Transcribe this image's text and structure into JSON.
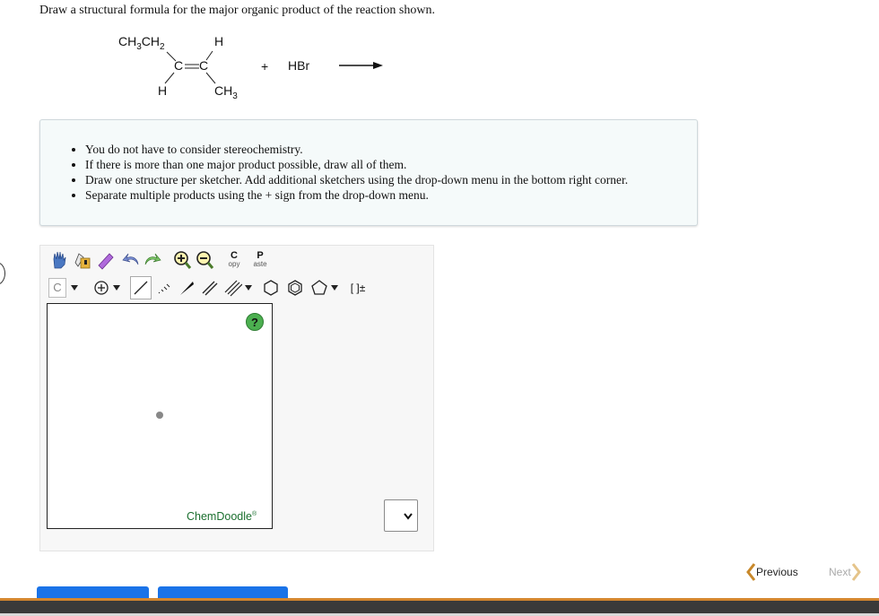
{
  "question": {
    "text": "Draw a structural formula for the major organic product of the reaction shown."
  },
  "reaction": {
    "sub_ch3ch2_main": "CH",
    "sub_ch3ch2_3": "3",
    "sub_ch3ch2_ch": "CH",
    "sub_ch3ch2_2": "2",
    "h_top": "H",
    "c_left": "C",
    "c_right": "C",
    "h_bottom": "H",
    "ch3_main": "CH",
    "ch3_sub": "3",
    "plus": "+",
    "reagent": "HBr"
  },
  "instructions": {
    "items": [
      "You do not have to consider stereochemistry.",
      "If there is more than one major product possible, draw all of them.",
      "Draw one structure per sketcher. Add additional sketchers using the drop-down menu in the bottom right corner.",
      "Separate multiple products using the + sign from the drop-down menu."
    ]
  },
  "toolbar": {
    "copy_top": "C",
    "copy_bottom": "opy",
    "paste_top": "P",
    "paste_bottom": "aste",
    "element": "C",
    "bracket": "[ ]±"
  },
  "sketcher": {
    "help": "?",
    "brand": "ChemDoodle",
    "brand_mark": "®"
  },
  "nav": {
    "previous": "Previous",
    "next": "Next"
  },
  "colors": {
    "accent_blue": "#1a73e8",
    "nav_orange": "#c8882a",
    "chemdoodle_green": "#1a6f2e"
  }
}
